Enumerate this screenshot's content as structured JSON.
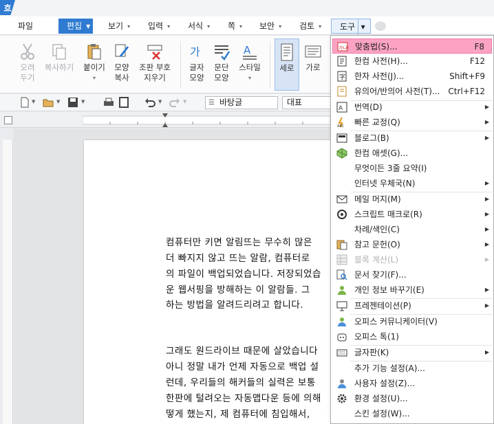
{
  "app": {
    "logo_text": "흐"
  },
  "menubar": {
    "items": [
      {
        "label": "파일"
      },
      {
        "label": "편집"
      },
      {
        "label": "보기"
      },
      {
        "label": "입력"
      },
      {
        "label": "서식"
      },
      {
        "label": "쪽"
      },
      {
        "label": "보안"
      },
      {
        "label": "검토"
      },
      {
        "label": "도구"
      }
    ]
  },
  "ribbon": {
    "cut": "오려\n두기",
    "copy": "복사하기",
    "paste": "붙이기",
    "format_copy": "모양\n복사",
    "clear_mark": "조판 부호\n지우기",
    "char_shape": "글자\n모양",
    "para_shape": "문단\n모양",
    "style": "스타일",
    "vertical": "세로",
    "horizontal": "가로"
  },
  "toolbar": {
    "style_value": "바탕글",
    "font_value": "대표"
  },
  "document": {
    "lines": [
      "컴퓨터만 키면 알림뜨는 무수히 많은",
      "더 빠지지 않고 뜨는 알람, 컴퓨터로",
      "의 파일이 백업되었습니다. 저장되었습",
      "운 웹서핑을 방해하는 이 알람들. 그",
      "하는 방법을 알려드리려고 합니다.",
      "그래도 원드라이브 때문에 살았습니다",
      "아니 정말 내가 언제 자동으로 백업 설",
      "런데, 우리들의 해커들의 실력은 보통",
      "한판에 털려오는 자동맵다운 등에 의해",
      "떻게 했는지, 제 컴퓨터에 침입해서,"
    ]
  },
  "tools_menu": {
    "items": [
      {
        "label": "맞춤법(S)...",
        "shortcut": "F8",
        "icon": "spell-check-icon"
      },
      {
        "label": "한컴 사전(H)...",
        "shortcut": "F12",
        "icon": "dictionary-icon"
      },
      {
        "label": "한자 사전(J)...",
        "shortcut": "Shift+F9",
        "icon": "hanja-dictionary-icon"
      },
      {
        "label": "유의어/반의어 사전(T)...",
        "shortcut": "Ctrl+F12",
        "icon": "thesaurus-icon"
      },
      {
        "label": "번역(D)",
        "icon": "translate-icon"
      },
      {
        "label": "빠른 교정(Q)",
        "icon": "quick-correct-icon"
      },
      {
        "label": "블로그(B)",
        "icon": "blog-icon"
      },
      {
        "label": "한컴 애셋(G)...",
        "icon": "asset-icon"
      },
      {
        "label": "무엇이든 3줄 요약(I)",
        "icon": ""
      },
      {
        "label": "인터넷 우체국(N)",
        "icon": ""
      },
      {
        "label": "메일 머지(M)",
        "icon": "mail-merge-icon"
      },
      {
        "label": "스크립트 매크로(R)",
        "icon": "macro-icon"
      },
      {
        "label": "차례/색인(C)",
        "icon": ""
      },
      {
        "label": "참고 문헌(O)",
        "icon": "references-icon"
      },
      {
        "label": "블록 계산(L)",
        "icon": "block-calc-icon"
      },
      {
        "label": "문서 찾기(F)...",
        "icon": "find-document-icon"
      },
      {
        "label": "개인 정보 바꾸기(E)",
        "icon": "privacy-icon"
      },
      {
        "label": "프레젠테이션(P)",
        "icon": "presentation-icon"
      },
      {
        "label": "오피스 커뮤니케이터(V)",
        "icon": "communicator-icon"
      },
      {
        "label": "오피스 톡(1)",
        "icon": "office-talk-icon"
      },
      {
        "label": "글자판(K)",
        "icon": "keyboard-icon"
      },
      {
        "label": "추가 기능 설정(A)...",
        "icon": ""
      },
      {
        "label": "사용자 설정(Z)...",
        "icon": "user-settings-icon"
      },
      {
        "label": "환경 설정(U)...",
        "icon": "gear-icon"
      },
      {
        "label": "스킨 설정(W)...",
        "icon": ""
      }
    ]
  },
  "colors": {
    "accent": "#2f7bd1",
    "highlight": "#fca3c3"
  }
}
